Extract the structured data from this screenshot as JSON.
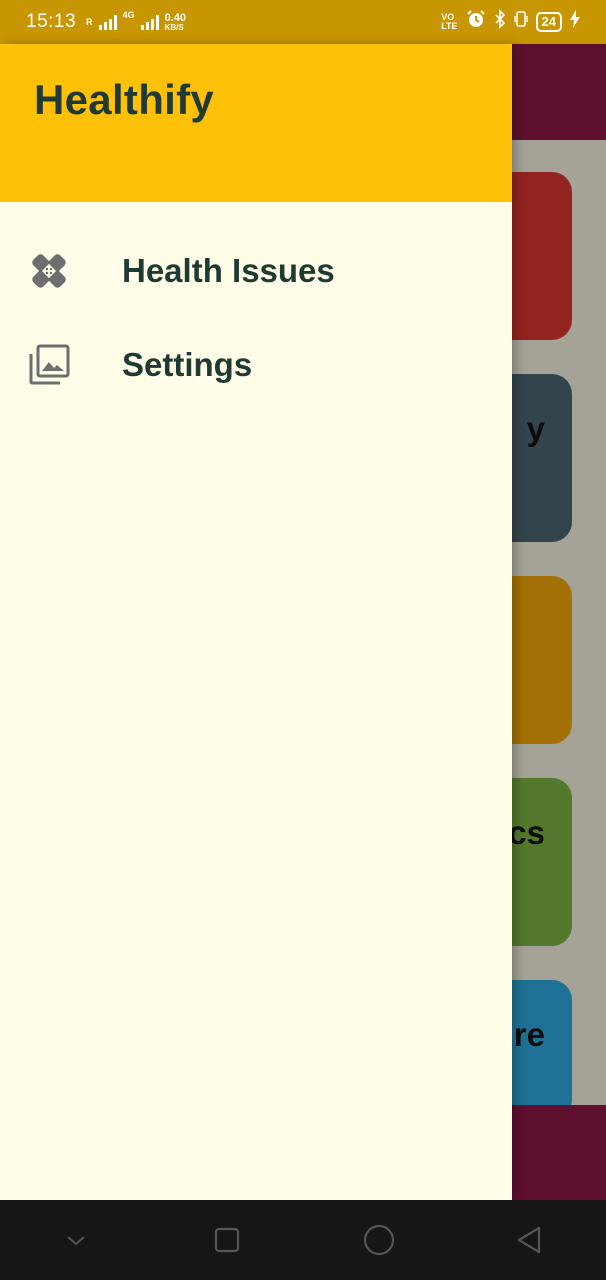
{
  "status_bar": {
    "time": "15:13",
    "roaming_indicator": "R",
    "network_type": "4G",
    "speed_value": "0.40",
    "speed_unit": "KB/S",
    "volte_top": "VO",
    "volte_bottom": "LTE",
    "battery_level": "24",
    "icons": [
      "signal-icon",
      "alarm-icon",
      "bluetooth-icon",
      "vibrate-icon",
      "battery-icon",
      "charging-icon"
    ]
  },
  "drawer": {
    "title": "Healthify",
    "items": [
      {
        "label": "Health Issues",
        "icon": "bandage-icon"
      },
      {
        "label": "Settings",
        "icon": "photo-library-icon"
      }
    ]
  },
  "background": {
    "cards": [
      {
        "partial_text": "",
        "color": "#d9352f"
      },
      {
        "partial_text": "y",
        "color": "#4d6572"
      },
      {
        "partial_text": "",
        "color": "#f1a70b"
      },
      {
        "partial_text": "cs",
        "color": "#7cb241"
      },
      {
        "partial_text": "re",
        "color": "#2ea7de"
      }
    ],
    "appbar_color": "#8d1845"
  },
  "nav_bar": {
    "buttons": [
      "chevron-down-icon",
      "recents-icon",
      "home-icon",
      "back-icon"
    ]
  },
  "colors": {
    "drawer_header": "#ffc107",
    "drawer_bg": "#fffde8",
    "text_dark": "#1f3a33",
    "status_bar": "#c79600"
  }
}
